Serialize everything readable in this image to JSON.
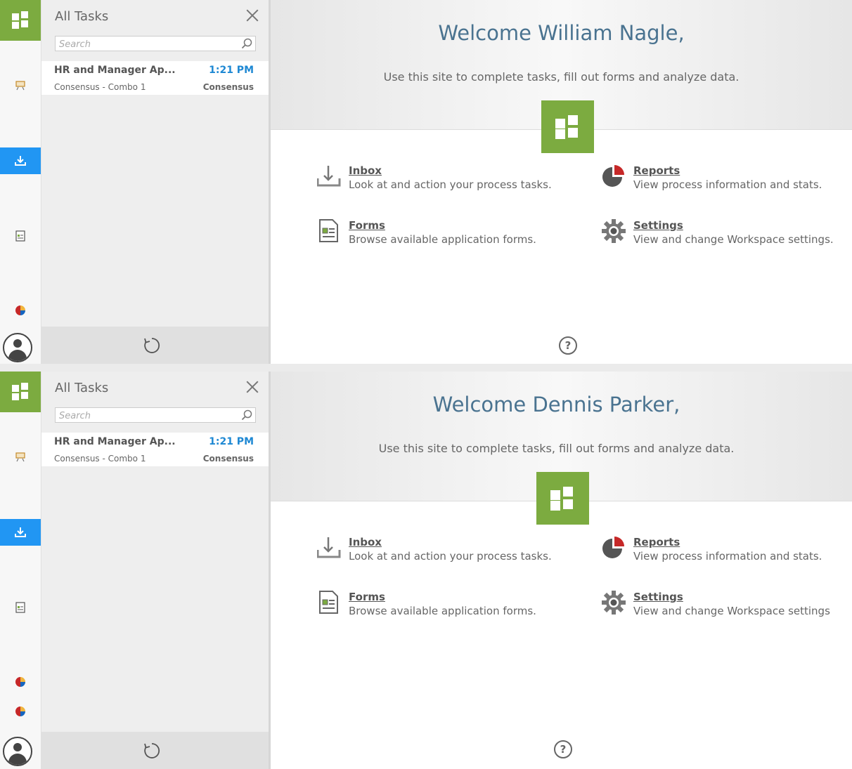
{
  "panels": [
    {
      "tasks": {
        "title": "All Tasks",
        "search_placeholder": "Search",
        "items": [
          {
            "title": "HR and Manager Ap...",
            "time": "1:21 PM",
            "subtitle": "Consensus - Combo 1",
            "source": "Consensus"
          }
        ]
      },
      "main": {
        "welcome": "Welcome William Nagle,",
        "tagline": "Use this site to complete tasks, fill out forms and analyze data.",
        "features": {
          "inbox": {
            "label": "Inbox",
            "desc": "Look at and action your process tasks."
          },
          "reports": {
            "label": "Reports",
            "desc": "View process information and stats."
          },
          "forms": {
            "label": "Forms",
            "desc": "Browse available application forms."
          },
          "settings": {
            "label": "Settings",
            "desc": "View and change Workspace settings."
          }
        },
        "help": "?"
      }
    },
    {
      "tasks": {
        "title": "All Tasks",
        "search_placeholder": "Search",
        "items": [
          {
            "title": "HR and Manager Ap...",
            "time": "1:21 PM",
            "subtitle": "Consensus - Combo 1",
            "source": "Consensus"
          }
        ]
      },
      "main": {
        "welcome": "Welcome Dennis Parker,",
        "tagline": "Use this site to complete tasks, fill out forms and analyze data.",
        "features": {
          "inbox": {
            "label": "Inbox",
            "desc": "Look at and action your process tasks."
          },
          "reports": {
            "label": "Reports",
            "desc": "View process information and stats."
          },
          "forms": {
            "label": "Forms",
            "desc": "Browse available application forms."
          },
          "settings": {
            "label": "Settings",
            "desc": "View and change Workspace settings"
          }
        },
        "help": "?"
      }
    }
  ],
  "colors": {
    "brand_green": "#7cab40",
    "active_blue": "#2196f3",
    "title_blue": "#4a7390",
    "time_blue": "#1e88d3",
    "report_red": "#c62828"
  },
  "icons": {
    "rail": [
      "home-grid-icon",
      "easel-icon",
      "inbox-download-icon",
      "form-icon",
      "pie-chart-icon",
      "user-avatar-icon"
    ],
    "main": [
      "inbox-tray-icon",
      "reports-pie-icon",
      "forms-document-icon",
      "settings-gear-icon",
      "help-icon",
      "refresh-icon",
      "search-icon",
      "close-icon"
    ]
  }
}
